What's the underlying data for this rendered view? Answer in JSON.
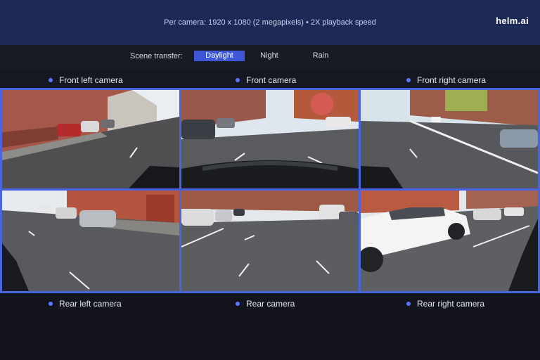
{
  "header": {
    "spec": "Per camera: 1920 x 1080 (2 megapixels) • 2X playback speed",
    "logo": "helm.ai"
  },
  "scene_transfer": {
    "label": "Scene transfer:",
    "options": [
      "Daylight",
      "Night",
      "Rain"
    ],
    "selected": "Daylight"
  },
  "cameras": {
    "front_left": "Front left camera",
    "front": "Front camera",
    "front_right": "Front right camera",
    "rear_left": "Rear left camera",
    "rear": "Rear camera",
    "rear_right": "Rear right camera"
  },
  "colors": {
    "accent": "#3d57d6",
    "header_bg": "#1d2a55",
    "frame_border": "#4a63e0"
  }
}
